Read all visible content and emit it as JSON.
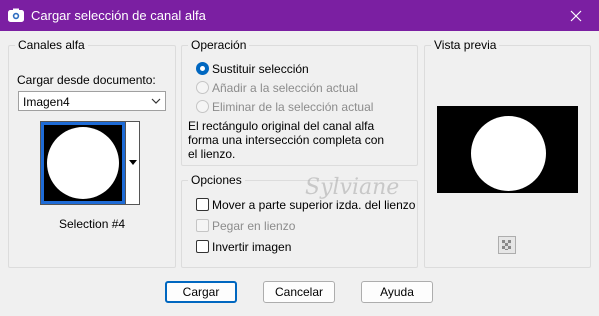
{
  "window": {
    "title": "Cargar selección de canal alfa",
    "titlebar_color": "#7b1fa2"
  },
  "canales": {
    "legend": "Canales alfa",
    "source_label": "Cargar desde documento:",
    "document_value": "Imagen4",
    "selection_label": "Selection #4"
  },
  "operacion": {
    "legend": "Operación",
    "options": [
      {
        "label": "Sustituir selección",
        "checked": true,
        "enabled": true
      },
      {
        "label": "Añadir a la selección actual",
        "checked": false,
        "enabled": false
      },
      {
        "label": "Eliminar de la selección actual",
        "checked": false,
        "enabled": false
      }
    ],
    "description_lines": [
      "El rectángulo original del canal alfa",
      "forma una intersección completa con",
      "el lienzo."
    ]
  },
  "opciones": {
    "legend": "Opciones",
    "items": [
      {
        "label": "Mover a parte superior izda. del lienzo",
        "checked": false,
        "enabled": true
      },
      {
        "label": "Pegar en lienzo",
        "checked": false,
        "enabled": false
      },
      {
        "label": "Invertir imagen",
        "checked": false,
        "enabled": true
      }
    ]
  },
  "preview": {
    "legend": "Vista previa"
  },
  "watermark": "Sylviane",
  "buttons": {
    "load": "Cargar",
    "cancel": "Cancelar",
    "help": "Ayuda"
  },
  "colors": {
    "accent": "#0067c0",
    "group_border": "#dcdcdc",
    "window_bg": "#f0f0f0"
  }
}
